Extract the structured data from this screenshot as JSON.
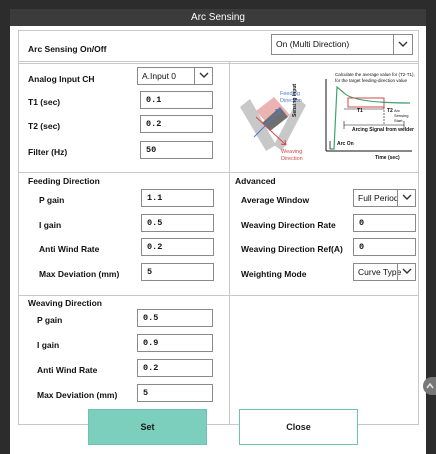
{
  "window": {
    "title": "Arc Sensing"
  },
  "arc_sensing": {
    "label": "Arc Sensing On/Off",
    "value": "On (Multi Direction)"
  },
  "analog": {
    "input_ch_label": "Analog Input CH",
    "input_ch_value": "A.Input 0",
    "t1_label": "T1 (sec)",
    "t1_value": "0.1",
    "t2_label": "T2 (sec)",
    "t2_value": "0.2",
    "filter_label": "Filter (Hz)",
    "filter_value": "50"
  },
  "diagram": {
    "feeding_direction": "Feeding Direction",
    "weaving_direction": "Weaving Direction",
    "sensing_input": "Sensing Input",
    "calc_note": "Calculate the average value for (T2-T1), for the target feeding-direction value",
    "t1": "T1",
    "t2": "T2",
    "arc_sensing_start": "Arc Sensing Start",
    "arcing_signal": "Arcing Signal from welder",
    "arc_on": "Arc On",
    "time_axis": "Time (sec)"
  },
  "feeding": {
    "header": "Feeding Direction",
    "p_gain_label": "P gain",
    "p_gain_value": "1.1",
    "i_gain_label": "I gain",
    "i_gain_value": "0.5",
    "anti_wind_label": "Anti Wind Rate",
    "anti_wind_value": "0.2",
    "max_dev_label": "Max Deviation (mm)",
    "max_dev_value": "5"
  },
  "advanced": {
    "header": "Advanced",
    "avg_window_label": "Average Window",
    "avg_window_value": "Full Period",
    "wdr_label": "Weaving Direction Rate",
    "wdr_value": "0",
    "wdref_label": "Weaving Direction Ref(A)",
    "wdref_value": "0",
    "weighting_label": "Weighting Mode",
    "weighting_value": "Curve Type"
  },
  "weaving": {
    "header": "Weaving Direction",
    "p_gain_label": "P gain",
    "p_gain_value": "0.5",
    "i_gain_label": "I gain",
    "i_gain_value": "0.9",
    "anti_wind_label": "Anti Wind Rate",
    "anti_wind_value": "0.2",
    "max_dev_label": "Max Deviation (mm)",
    "max_dev_value": "5"
  },
  "buttons": {
    "set": "Set",
    "close": "Close"
  },
  "colors": {
    "accent": "#7ccfbd",
    "titlebar": "#3b3b3b",
    "backdrop": "#2c2c2c"
  }
}
